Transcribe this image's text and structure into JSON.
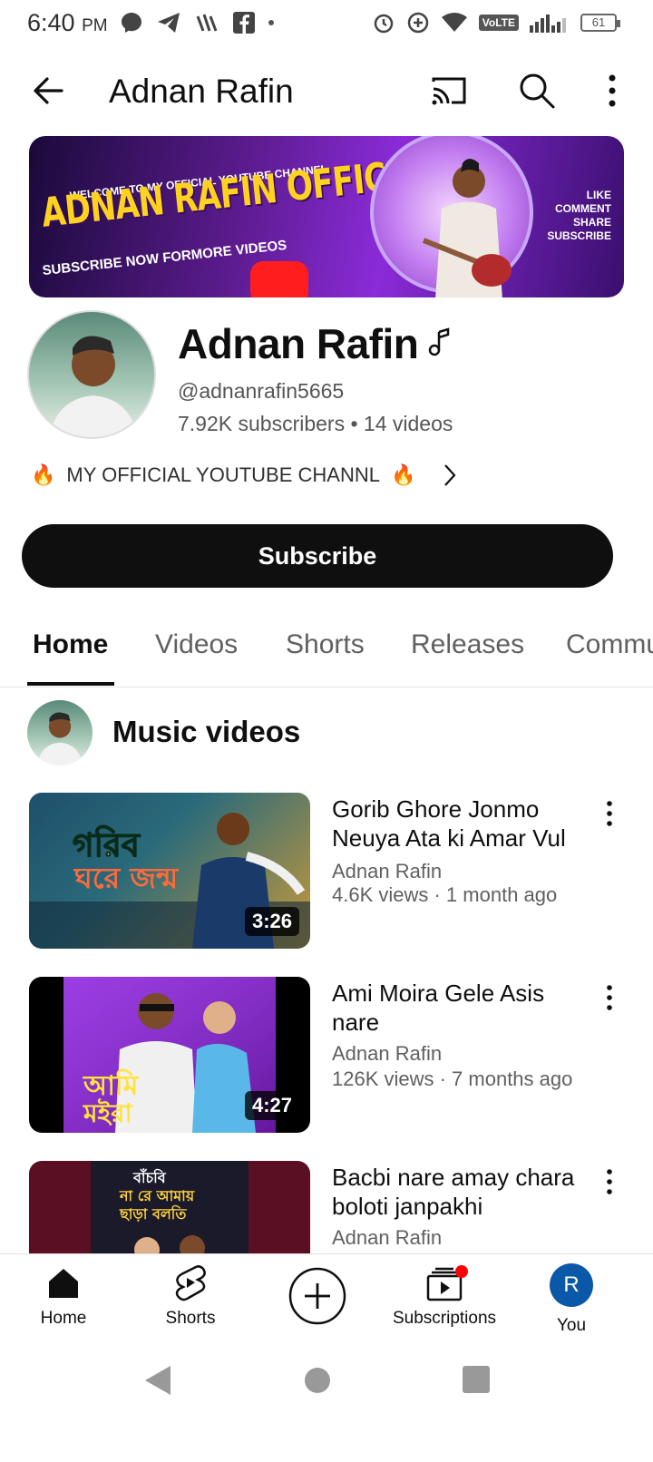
{
  "status_bar": {
    "time": "6:40",
    "ampm": "PM",
    "network_badge": "VoLTE",
    "battery": "61"
  },
  "app_bar": {
    "title": "Adnan Rafin"
  },
  "banner": {
    "welcome": "WELCOME TO MY OFFICIAL YOUTUBE CHANNEL",
    "title": "ADNAN RAFIN OFFICIAL",
    "subtitle": "SUBSCRIBE NOW FORMORE VIDEOS",
    "actions": [
      "LIKE",
      "COMMENT",
      "SHARE",
      "SUBSCRIBE"
    ]
  },
  "channel": {
    "name": "Adnan Rafin",
    "handle": "@adnanrafin5665",
    "stats": "7.92K subscribers • 14 videos",
    "description": "MY OFFICIAL YOUTUBE CHANNL",
    "subscribe_label": "Subscribe"
  },
  "tabs": [
    {
      "label": "Home",
      "active": true
    },
    {
      "label": "Videos",
      "active": false
    },
    {
      "label": "Shorts",
      "active": false
    },
    {
      "label": "Releases",
      "active": false
    },
    {
      "label": "Community",
      "active": false
    }
  ],
  "section": {
    "title": "Music videos"
  },
  "videos": [
    {
      "title": "Gorib Ghore Jonmo Neuya Ata ki Amar Vul Adnan Rafin",
      "channel": "Adnan Rafin",
      "meta": "4.6K views · 1 month ago",
      "duration": "3:26"
    },
    {
      "title": "Ami Moira Gele Asis nare",
      "channel": "Adnan Rafin",
      "meta": "126K views · 7 months ago",
      "duration": "4:27"
    },
    {
      "title": "Bacbi nare amay chara boloti janpakhi",
      "channel": "Adnan Rafin",
      "meta": "",
      "duration": ""
    }
  ],
  "bottom_nav": {
    "home": "Home",
    "shorts": "Shorts",
    "subscriptions": "Subscriptions",
    "you": "You",
    "you_initial": "R"
  },
  "colors": {
    "subscribe_bg": "#0f0f0f",
    "avatar_blue": "#0b57a8",
    "notification_red": "#ff0000"
  }
}
